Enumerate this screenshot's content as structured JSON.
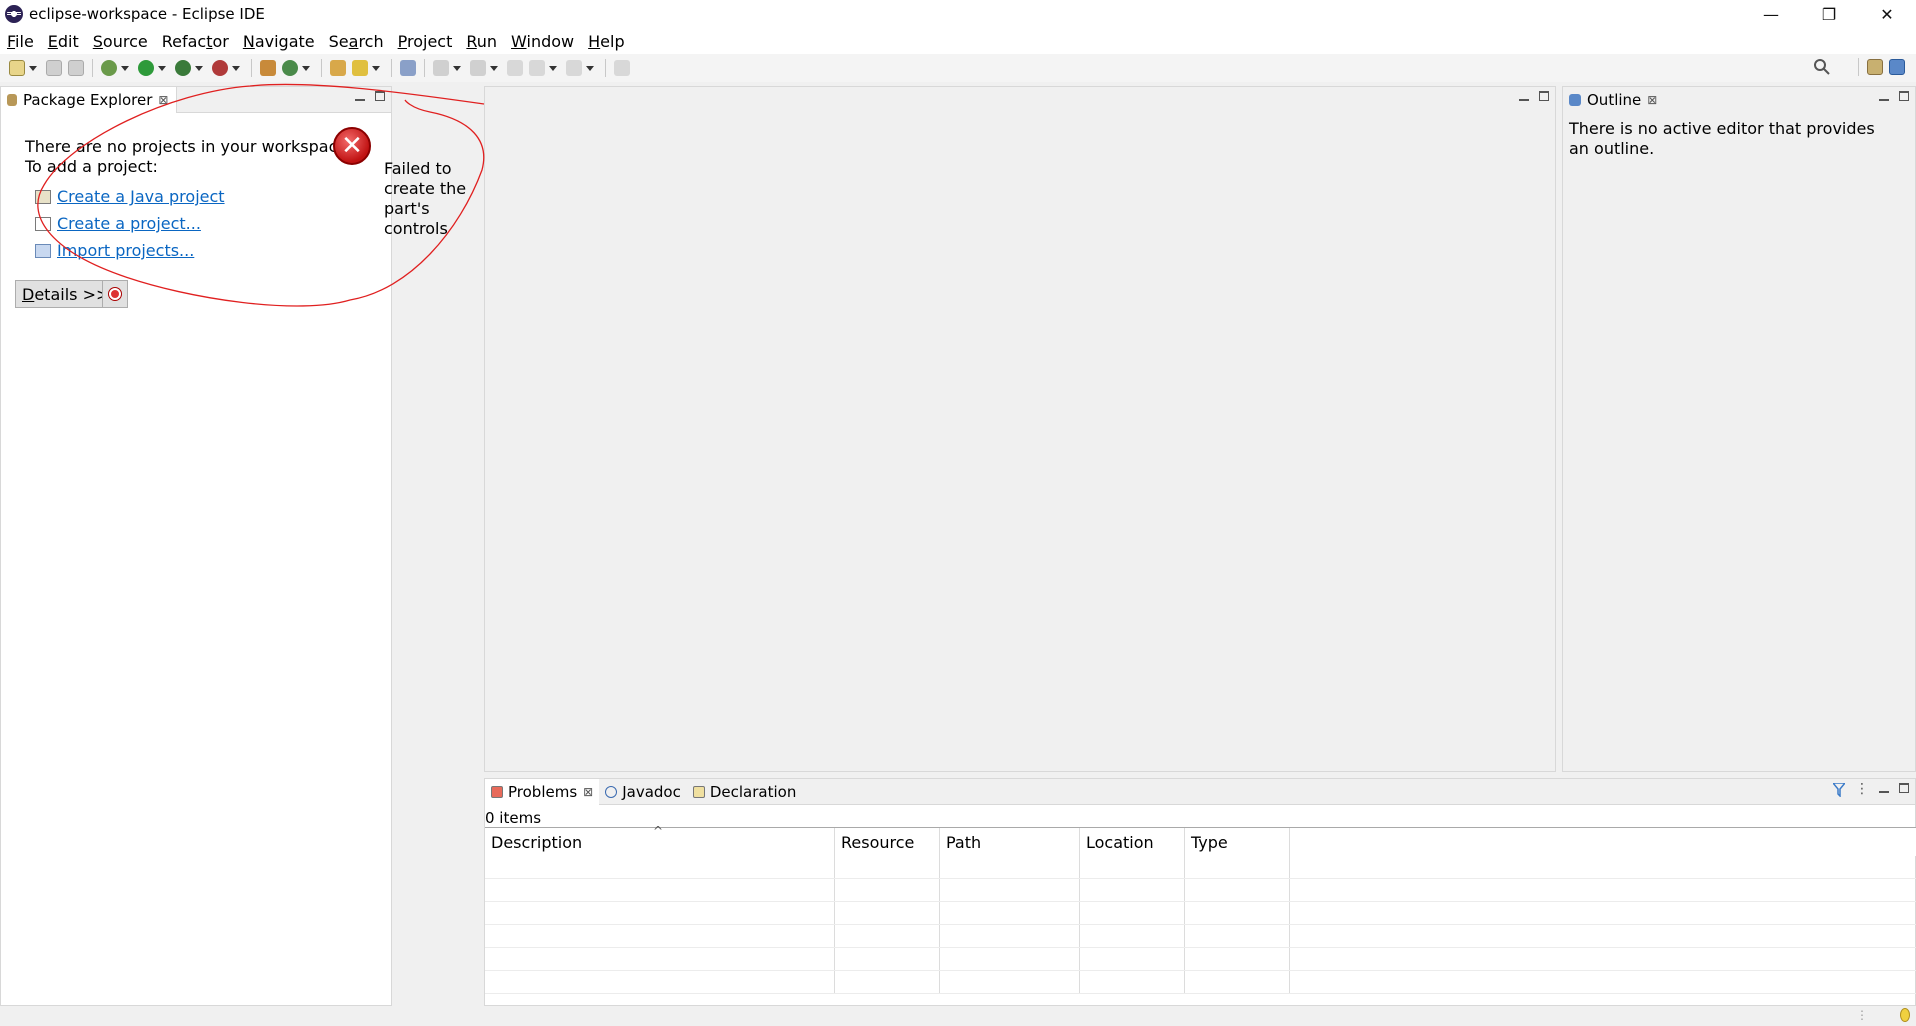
{
  "window": {
    "title": "eclipse-workspace - Eclipse IDE",
    "controls": {
      "minimize": "—",
      "restore": "❐",
      "close": "✕"
    }
  },
  "menubar": [
    {
      "pre": "",
      "ul": "F",
      "post": "ile"
    },
    {
      "pre": "",
      "ul": "E",
      "post": "dit"
    },
    {
      "pre": "",
      "ul": "S",
      "post": "ource"
    },
    {
      "pre": "Refac",
      "ul": "t",
      "post": "or"
    },
    {
      "pre": "",
      "ul": "N",
      "post": "avigate"
    },
    {
      "pre": "Se",
      "ul": "a",
      "post": "rch"
    },
    {
      "pre": "",
      "ul": "P",
      "post": "roject"
    },
    {
      "pre": "",
      "ul": "R",
      "post": "un"
    },
    {
      "pre": "",
      "ul": "W",
      "post": "indow"
    },
    {
      "pre": "",
      "ul": "H",
      "post": "elp"
    }
  ],
  "package_explorer": {
    "tab_label": "Package Explorer",
    "close_glyph": "⊠",
    "message_line1": "There are no projects in your workspace.",
    "message_line2": "To add a project:",
    "links": {
      "create_java": "Create a Java project",
      "create_project": "Create a project...",
      "import_projects": "Import projects..."
    },
    "error_glyph": "✕",
    "error_text": "Failed to create the part's controls",
    "details_button": {
      "ul": "D",
      "post": "etails >>"
    }
  },
  "outline": {
    "tab_label": "Outline",
    "close_glyph": "⊠",
    "message": "There is no active editor that provides an outline."
  },
  "problems": {
    "tabs": {
      "problems": "Problems",
      "javadoc": "Javadoc",
      "declaration": "Declaration"
    },
    "close_glyph": "⊠",
    "items_count": "0 items",
    "sort_caret": "^",
    "columns": {
      "description": "Description",
      "resource": "Resource",
      "path": "Path",
      "location": "Location",
      "type": "Type"
    }
  },
  "colors": {
    "link": "#0a66c2",
    "error_red": "#c01212",
    "annotation_red": "#e02020"
  }
}
